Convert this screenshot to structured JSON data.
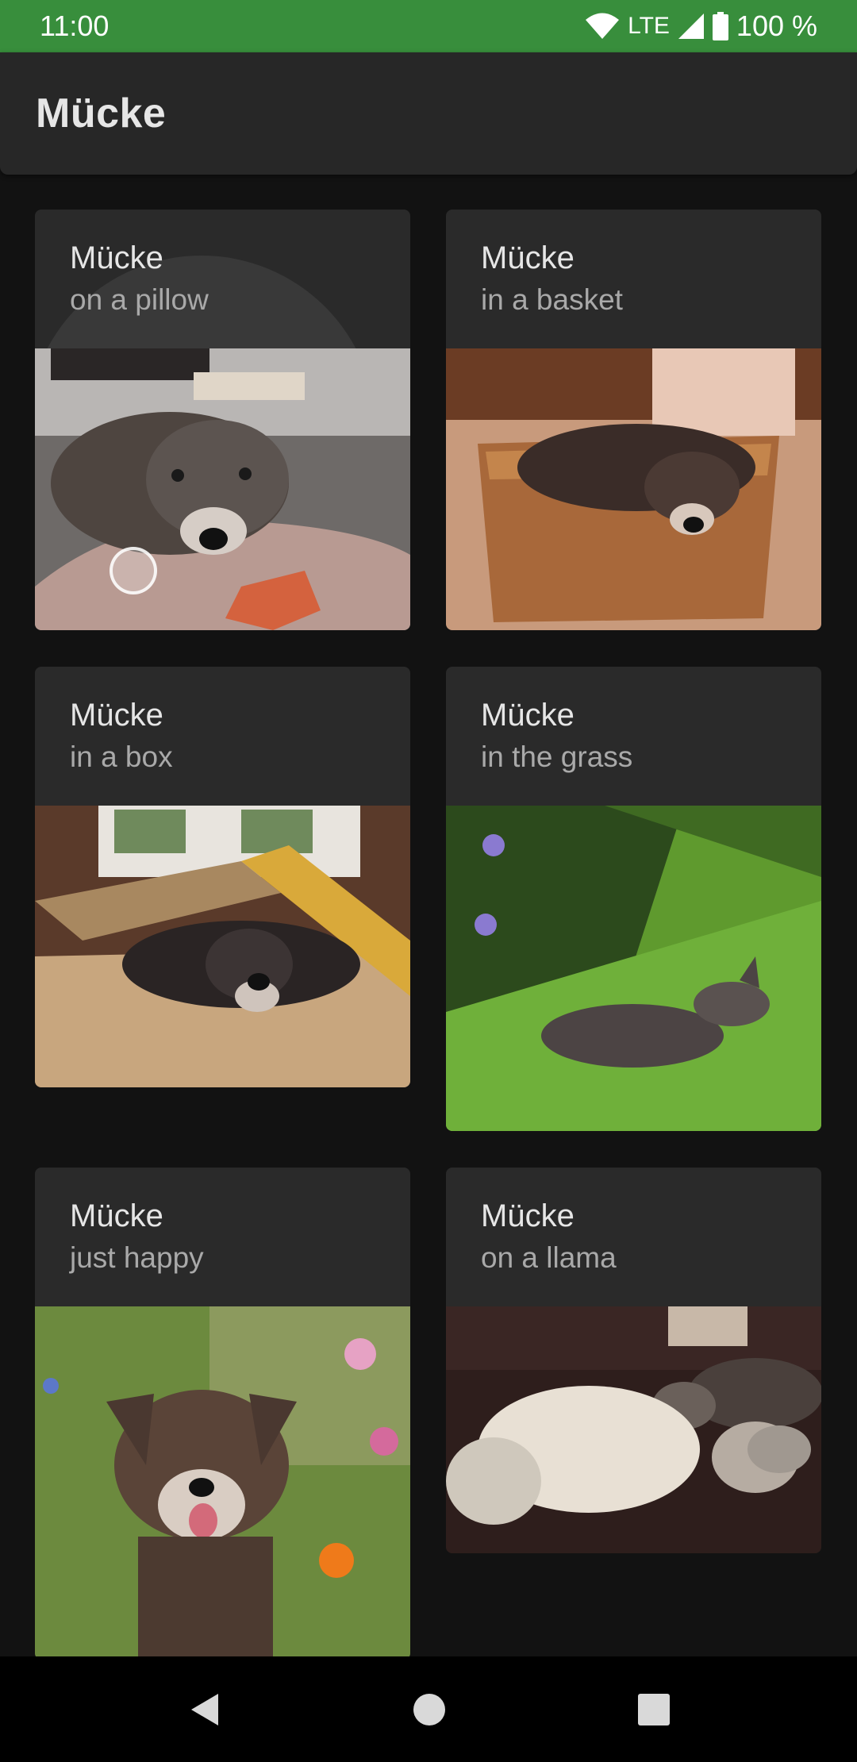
{
  "status_bar": {
    "time": "11:00",
    "network": "LTE",
    "battery": "100 %",
    "icons": [
      "wifi-icon",
      "signal-icon",
      "battery-icon"
    ],
    "background": "#388e3c"
  },
  "app_bar": {
    "title": "Mücke"
  },
  "cards": [
    {
      "title": "Mücke",
      "subtitle": "on a pillow"
    },
    {
      "title": "Mücke",
      "subtitle": "in a basket"
    },
    {
      "title": "Mücke",
      "subtitle": "in a box"
    },
    {
      "title": "Mücke",
      "subtitle": "in the grass"
    },
    {
      "title": "Mücke",
      "subtitle": "just happy"
    },
    {
      "title": "Mücke",
      "subtitle": "on a llama"
    }
  ],
  "nav_bar": {
    "icons": [
      "back-icon",
      "home-icon",
      "recents-icon"
    ]
  }
}
